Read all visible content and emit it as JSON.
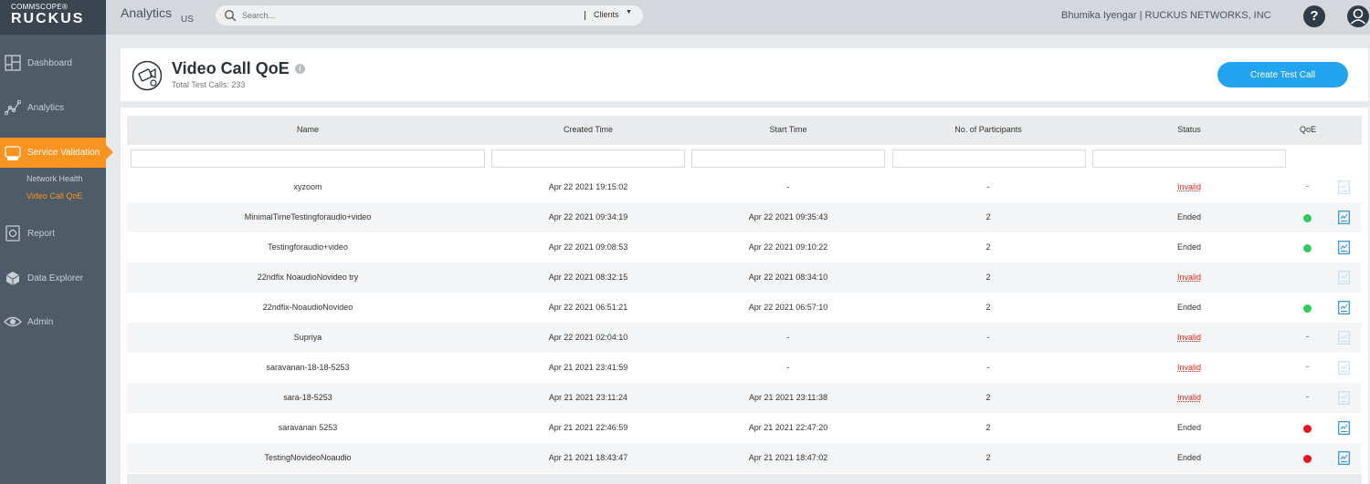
{
  "brand": {
    "top": "COMMSCOPE®",
    "name": "RUCKUS"
  },
  "sidebar": {
    "items": [
      {
        "label": "Dashboard",
        "icon": "dashboard-icon"
      },
      {
        "label": "Analytics",
        "icon": "analytics-icon"
      },
      {
        "label": "Service Validation",
        "icon": "service-validation-icon",
        "active": true
      },
      {
        "label": "Report",
        "icon": "report-icon"
      },
      {
        "label": "Data Explorer",
        "icon": "data-explorer-icon"
      },
      {
        "label": "Admin",
        "icon": "admin-icon"
      }
    ],
    "subitems": [
      {
        "label": "Network Health"
      },
      {
        "label": "Video Call QoE",
        "active": true
      }
    ]
  },
  "topbar": {
    "title": "Analytics",
    "region": "US",
    "search_placeholder": "Search...",
    "search_scope": "Clients",
    "user": "Bhumika Iyengar | RUCKUS NETWORKS, INC"
  },
  "page": {
    "title": "Video Call QoE",
    "subtitle": "Total Test Calls: 233",
    "create_button": "Create Test Call"
  },
  "table": {
    "columns": [
      "Name",
      "Created Time",
      "Start Time",
      "No. of Participants",
      "Status",
      "QoE"
    ],
    "rows": [
      {
        "name": "xyzoom",
        "created": "Apr 22 2021 19:15:02",
        "start": "-",
        "participants": "-",
        "status": "Invalid",
        "qoe": "none"
      },
      {
        "name": "MinimalTimeTestingforaudio+video",
        "created": "Apr 22 2021 09:34:19",
        "start": "Apr 22 2021 09:35:43",
        "participants": "2",
        "status": "Ended",
        "qoe": "good"
      },
      {
        "name": "Testingforaudio+video",
        "created": "Apr 22 2021 09:08:53",
        "start": "Apr 22 2021 09:10:22",
        "participants": "2",
        "status": "Ended",
        "qoe": "good"
      },
      {
        "name": "22ndfix NoaudioNovideo try",
        "created": "Apr 22 2021 08:32:15",
        "start": "Apr 22 2021 08:34:10",
        "participants": "2",
        "status": "Invalid",
        "qoe": "blank"
      },
      {
        "name": "22ndfix-NoaudioNovideo",
        "created": "Apr 22 2021 06:51:21",
        "start": "Apr 22 2021 06:57:10",
        "participants": "2",
        "status": "Ended",
        "qoe": "good"
      },
      {
        "name": "Supriya",
        "created": "Apr 22 2021 02:04:10",
        "start": "-",
        "participants": "-",
        "status": "Invalid",
        "qoe": "none"
      },
      {
        "name": "saravanan-18-18-5253",
        "created": "Apr 21 2021 23:41:59",
        "start": "-",
        "participants": "-",
        "status": "Invalid",
        "qoe": "none"
      },
      {
        "name": "sara-18-5253",
        "created": "Apr 21 2021 23:11:24",
        "start": "Apr 21 2021 23:11:38",
        "participants": "2",
        "status": "Invalid",
        "qoe": "none"
      },
      {
        "name": "saravanan 5253",
        "created": "Apr 21 2021 22:46:59",
        "start": "Apr 21 2021 22:47:20",
        "participants": "2",
        "status": "Ended",
        "qoe": "bad"
      },
      {
        "name": "TestingNovideoNoaudio",
        "created": "Apr 21 2021 18:43:47",
        "start": "Apr 21 2021 18:47:02",
        "participants": "2",
        "status": "Ended",
        "qoe": "bad"
      }
    ]
  },
  "colors": {
    "sidebar": "#4f5b66",
    "accent": "#f7931e",
    "button": "#23a4f0",
    "good": "#2ecc5e",
    "bad": "#e8141e",
    "invalid": "#d52b1e"
  }
}
